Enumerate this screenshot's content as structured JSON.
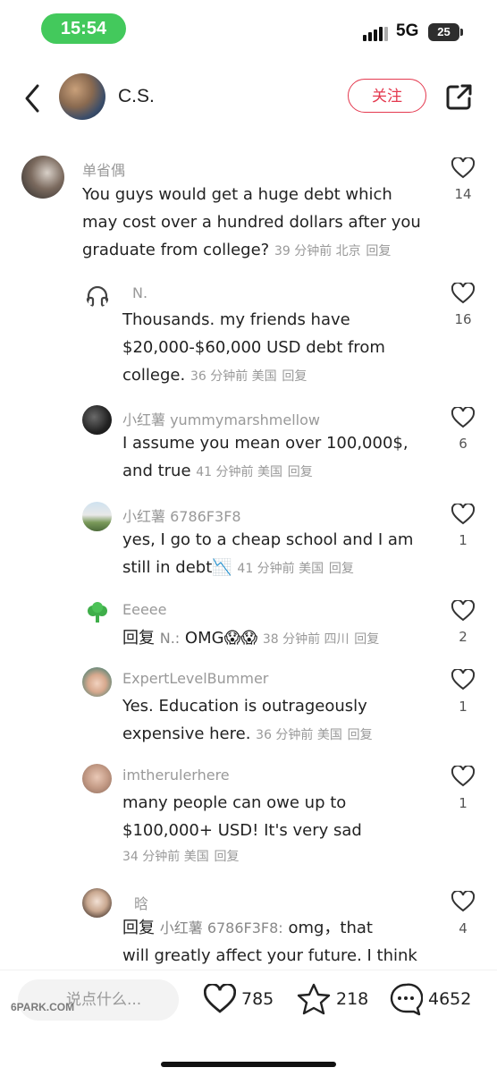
{
  "status_bar": {
    "time": "15:54",
    "network": "5G",
    "battery": "25"
  },
  "header": {
    "author": "C.S.",
    "follow_label": "关注"
  },
  "comments": [
    {
      "user": "单省偶",
      "text_lines": [
        "You guys would get a huge debt which",
        "may cost over a hundred dollars after you",
        "graduate from college?"
      ],
      "meta": "39 分钟前  北京",
      "reply": "回复",
      "likes": "14"
    },
    {
      "user": "N.",
      "text_lines": [
        "Thousands. my friends have",
        "$20,000-$60,000 USD debt from",
        "college."
      ],
      "meta": "36 分钟前  美国",
      "reply": "回复",
      "likes": "16"
    },
    {
      "user": "小红薯 yummymarshmellow",
      "text_lines": [
        "I assume you mean over 100,000$,",
        "and true"
      ],
      "meta": "41 分钟前  美国",
      "reply": "回复",
      "likes": "6"
    },
    {
      "user": "小红薯 6786F3F8",
      "text_lines": [
        "yes, I go to a cheap school and I am",
        "still in debt📉"
      ],
      "meta": "41 分钟前  美国",
      "reply": "回复",
      "likes": "1"
    },
    {
      "user": "Eeeee",
      "reply_prefix": "回复",
      "reply_target": "N.:",
      "text_lines": [
        "OMG😱😱"
      ],
      "meta": "38 分钟前  四川",
      "reply": "回复",
      "likes": "2"
    },
    {
      "user": "ExpertLevelBummer",
      "text_lines": [
        "Yes. Education is outrageously",
        "expensive here."
      ],
      "meta": "36 分钟前  美国",
      "reply": "回复",
      "likes": "1"
    },
    {
      "user": "imtherulerhere",
      "text_lines": [
        "many people can owe up to",
        "$100,000+ USD! It's very sad"
      ],
      "meta": "34 分钟前  美国",
      "reply": "回复",
      "likes": "1"
    },
    {
      "user": "晗",
      "reply_prefix": "回复",
      "reply_target": "小红薯 6786F3F8:",
      "text_lines": [
        "omg，that",
        "will greatly affect your future. I think"
      ],
      "likes": "4"
    }
  ],
  "bottom_bar": {
    "input_placeholder": "说点什么...",
    "watermark": "6PARK.COM",
    "likes": "785",
    "favorites": "218",
    "comments": "4652"
  },
  "colors": {
    "accent": "#e4394f",
    "status_green": "#43c95c"
  }
}
